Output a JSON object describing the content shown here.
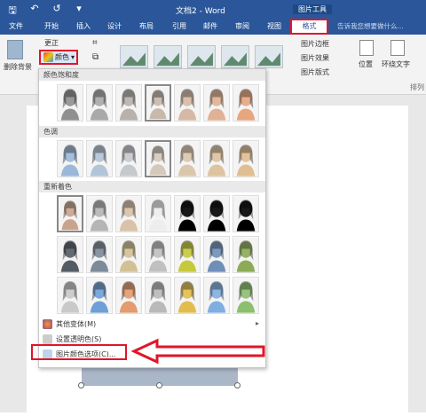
{
  "window": {
    "doc_title": "文档2 - Word",
    "tools_label": "图片工具"
  },
  "tabs": [
    "文件",
    "开始",
    "插入",
    "设计",
    "布局",
    "引用",
    "邮件",
    "审阅",
    "视图"
  ],
  "format_tab": "格式",
  "tell_me": "告诉我您想要做什么...",
  "ribbon": {
    "remove_bg": "删除背景",
    "corrections": "更正",
    "color_button": "颜色",
    "border": "图片边框",
    "effects": "图片效果",
    "layout": "图片版式",
    "position": "位置",
    "wrap": "环绕文字",
    "arrange": "排列"
  },
  "menu": {
    "saturation": "颜色饱和度",
    "tone": "色调",
    "recolor": "重新着色",
    "more_variants": "其他变体(M)",
    "set_transparent": "设置透明色(S)",
    "picture_options": "图片颜色选项(C)..."
  },
  "colors": {
    "accent": "#2b579a",
    "highlight": "#e0162b"
  },
  "swatches": {
    "saturation": [
      "#8f8f8f",
      "#a9a9a9",
      "#b7b1ac",
      "#c7b9ac",
      "#d6b9a4",
      "#e0b194",
      "#e7a67f"
    ],
    "tone": [
      "#9bb8d8",
      "#b2c4d8",
      "#c6c9cc",
      "#d4c9ba",
      "#dac7ab",
      "#ddc39f",
      "#e0be92"
    ],
    "recolor1": [
      "#c9a38c",
      "#b5b5b5",
      "#d8c2a8",
      "#ededed",
      "#000000",
      "#000000",
      "#000000"
    ],
    "recolor2": [
      "#555c66",
      "#7d8a99",
      "#d3c196",
      "#c0c0c0",
      "#c5c93b",
      "#6f8fb8",
      "#8bab57"
    ],
    "recolor3": [
      "#c9c9c9",
      "#6e9fd6",
      "#e39b6f",
      "#b9b9b9",
      "#e2bd4d",
      "#7faee0",
      "#8cbf6f"
    ]
  }
}
